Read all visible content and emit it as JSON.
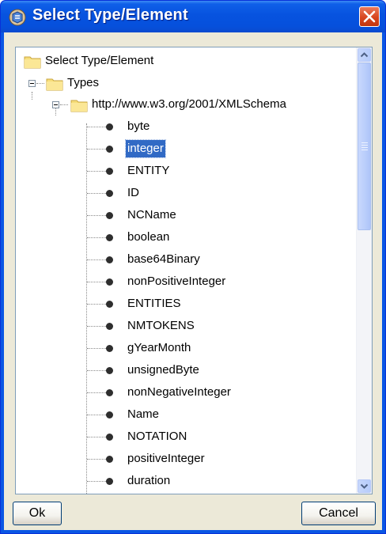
{
  "window": {
    "title": "Select Type/Element"
  },
  "tree": {
    "root_label": "Select Type/Element",
    "types_label": "Types",
    "namespace_label": "http://www.w3.org/2001/XMLSchema",
    "items": [
      {
        "label": "byte",
        "selected": false
      },
      {
        "label": "integer",
        "selected": true
      },
      {
        "label": "ENTITY",
        "selected": false
      },
      {
        "label": "ID",
        "selected": false
      },
      {
        "label": "NCName",
        "selected": false
      },
      {
        "label": "boolean",
        "selected": false
      },
      {
        "label": "base64Binary",
        "selected": false
      },
      {
        "label": "nonPositiveInteger",
        "selected": false
      },
      {
        "label": "ENTITIES",
        "selected": false
      },
      {
        "label": "NMTOKENS",
        "selected": false
      },
      {
        "label": "gYearMonth",
        "selected": false
      },
      {
        "label": "unsignedByte",
        "selected": false
      },
      {
        "label": "nonNegativeInteger",
        "selected": false
      },
      {
        "label": "Name",
        "selected": false
      },
      {
        "label": "NOTATION",
        "selected": false
      },
      {
        "label": "positiveInteger",
        "selected": false
      },
      {
        "label": "duration",
        "selected": false
      }
    ]
  },
  "buttons": {
    "ok_label": "Ok",
    "cancel_label": "Cancel"
  },
  "colors": {
    "title_bar": "#0753df",
    "selection": "#316ac5",
    "dialog_face": "#ece9d8",
    "close_button": "#d8451e"
  }
}
